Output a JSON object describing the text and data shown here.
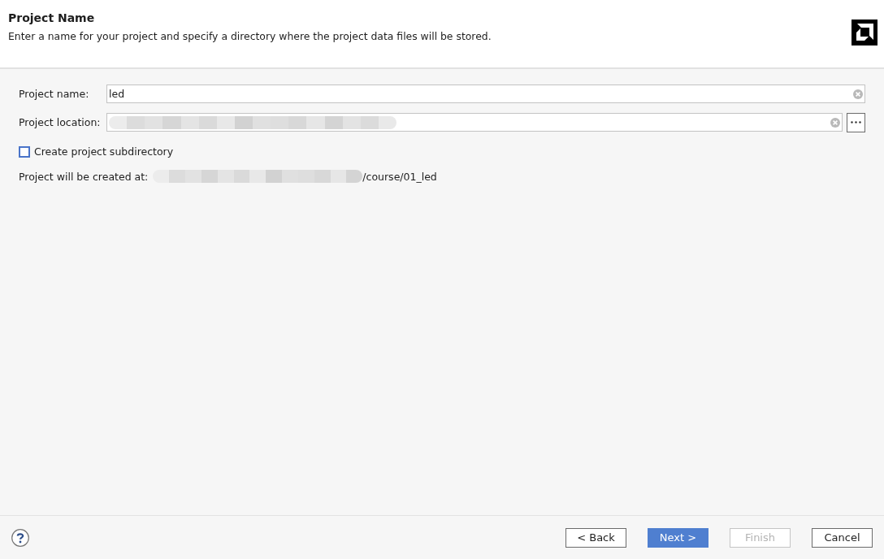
{
  "header": {
    "title": "Project Name",
    "description": "Enter a name for your project and specify a directory where the project data files will be stored."
  },
  "fields": [
    {
      "label": "Project name:",
      "value": "led"
    },
    {
      "label": "Project location:",
      "redacted": true,
      "browse": true
    }
  ],
  "checkbox": {
    "label": "Create project subdirectory",
    "checked": false
  },
  "path_line": {
    "label": "Project will be created at:",
    "redacted": true,
    "value": "/course/01_led"
  },
  "buttons": [
    {
      "label": "< Back",
      "kind": "default",
      "disabled": false
    },
    {
      "label": "Next >",
      "kind": "primary",
      "disabled": false
    },
    {
      "label": "Finish",
      "kind": "default",
      "disabled": true
    },
    {
      "label": "Cancel",
      "kind": "default",
      "disabled": false
    }
  ]
}
